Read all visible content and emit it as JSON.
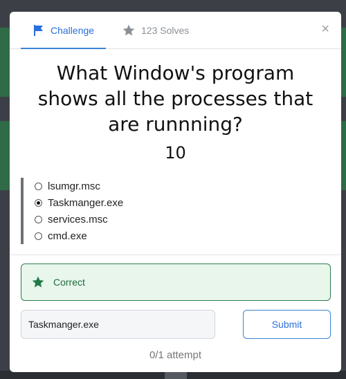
{
  "tabs": {
    "challenge_label": "Challenge",
    "solves_label": "123 Solves"
  },
  "close_symbol": "×",
  "question": {
    "text": "What Window's program shows all the processes that are runnning?",
    "points": "10"
  },
  "options": [
    {
      "label": "lsumgr.msc",
      "selected": false
    },
    {
      "label": "Taskmanger.exe",
      "selected": true
    },
    {
      "label": "services.msc",
      "selected": false
    },
    {
      "label": "cmd.exe",
      "selected": false
    }
  ],
  "result": {
    "label": "Correct",
    "icon": "star-icon"
  },
  "answer": {
    "value": "Taskmanger.exe"
  },
  "submit_label": "Submit",
  "attempts_text": "0/1 attempt",
  "colors": {
    "accent": "#2a6fdb",
    "success": "#1f6b3e",
    "success_bg": "#e8f6ec"
  }
}
